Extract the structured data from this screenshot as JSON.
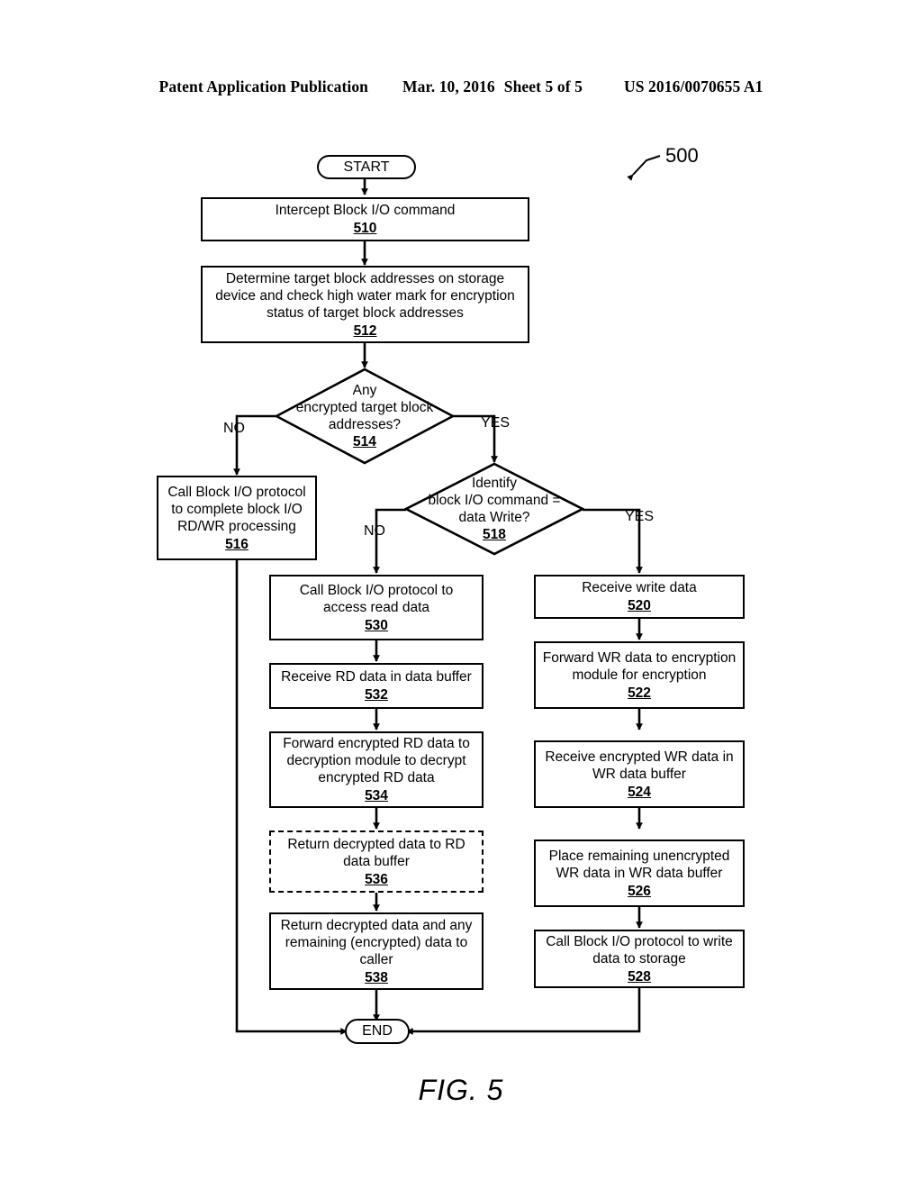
{
  "header": {
    "publication": "Patent Application Publication",
    "date": "Mar. 10, 2016",
    "sheet": "Sheet 5 of 5",
    "docnum": "US 2016/0070655 A1"
  },
  "figure": {
    "reference_number": "500",
    "caption": "FIG. 5"
  },
  "terminators": {
    "start": "START",
    "end": "END"
  },
  "branches": {
    "d514_no": "NO",
    "d514_yes": "YES",
    "d518_no": "NO",
    "d518_yes": "YES"
  },
  "nodes": {
    "n510": {
      "label": "Intercept Block I/O command",
      "ref": "510"
    },
    "n512": {
      "label": "Determine target block addresses on storage\ndevice and check high water mark for encryption\nstatus of target block addresses",
      "ref": "512"
    },
    "n514": {
      "label": "Any\nencrypted target block\naddresses?",
      "ref": "514"
    },
    "n516": {
      "label": "Call Block I/O protocol\nto complete block I/O\nRD/WR processing",
      "ref": "516"
    },
    "n518": {
      "label": "Identify\nblock I/O command =\ndata Write?",
      "ref": "518"
    },
    "n520": {
      "label": "Receive write data",
      "ref": "520"
    },
    "n522": {
      "label": "Forward WR data to encryption\nmodule for encryption",
      "ref": "522"
    },
    "n524": {
      "label": "Receive encrypted WR data in\nWR data buffer",
      "ref": "524"
    },
    "n526": {
      "label": "Place remaining unencrypted\nWR data in WR data buffer",
      "ref": "526"
    },
    "n528": {
      "label": "Call Block I/O protocol to write\ndata to storage",
      "ref": "528"
    },
    "n530": {
      "label": "Call Block I/O protocol to\naccess read data",
      "ref": "530"
    },
    "n532": {
      "label": "Receive RD data in data buffer",
      "ref": "532"
    },
    "n534": {
      "label": "Forward encrypted RD data to\ndecryption module to decrypt\nencrypted RD data",
      "ref": "534"
    },
    "n536": {
      "label": "Return decrypted data to RD\ndata buffer",
      "ref": "536"
    },
    "n538": {
      "label": "Return decrypted data and any\nremaining (encrypted) data to\ncaller",
      "ref": "538"
    }
  }
}
